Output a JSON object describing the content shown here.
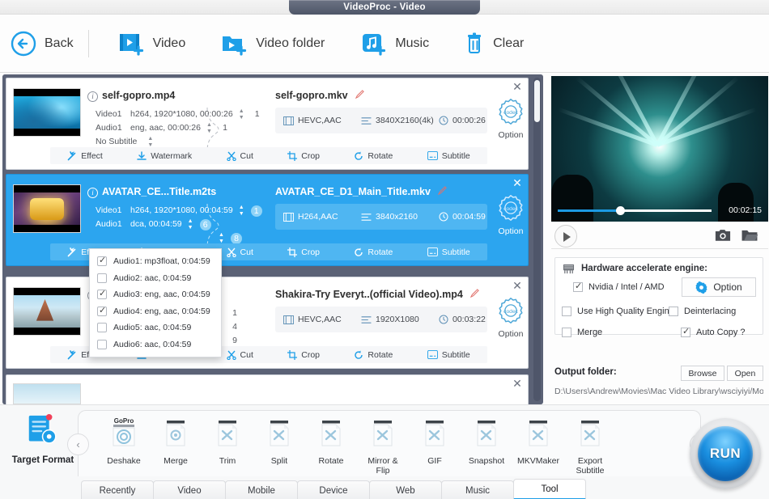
{
  "window": {
    "title": "VideoProc - Video"
  },
  "toolbar": {
    "back": "Back",
    "video": "Video",
    "video_folder": "Video folder",
    "music": "Music",
    "clear": "Clear"
  },
  "rows": [
    {
      "source_name": "self-gopro.mp4",
      "output_name": "self-gopro.mkv",
      "video_label": "Video1",
      "video_info": "h264, 1920*1080, 00:00:26",
      "video_count": "1",
      "audio_label": "Audio1",
      "audio_info": "eng, aac, 00:00:26",
      "audio_count": "1",
      "subtitle_info": "No Subtitle",
      "subtitle_count": "",
      "codec": "HEVC,AAC",
      "resolution": "3840X2160(4k)",
      "duration": "00:00:26",
      "option": "Option",
      "thumb": "sea",
      "selected": false
    },
    {
      "source_name": "AVATAR_CE...Title.m2ts",
      "output_name": "AVATAR_CE_D1_Main_Title.mkv",
      "video_label": "Video1",
      "video_info": "h264, 1920*1080, 00:04:59",
      "video_count": "1",
      "audio_label": "Audio1",
      "audio_info": "dca, 00:04:59",
      "audio_count": "6",
      "subtitle_info": "",
      "subtitle_count": "8",
      "codec": "H264,AAC",
      "resolution": "3840x2160",
      "duration": "00:04:59",
      "option": "Option",
      "thumb": "fox",
      "selected": true
    },
    {
      "source_name": "",
      "output_name": "Shakira-Try Everyt..(official Video).mp4",
      "video_label": "",
      "video_info": "",
      "video_count": "1",
      "audio_label": "",
      "audio_info": "",
      "audio_count": "4",
      "subtitle_info": "",
      "subtitle_count": "9",
      "codec": "HEVC,AAC",
      "resolution": "1920X1080",
      "duration": "00:03:22",
      "option": "Option",
      "thumb": "city",
      "selected": false
    }
  ],
  "row_actions": [
    "Effect",
    "Watermark",
    "Cut",
    "Crop",
    "Rotate",
    "Subtitle"
  ],
  "audio_dropdown": {
    "items": [
      {
        "label": "Audio1: mp3float, 0:04:59",
        "checked": true
      },
      {
        "label": "Audio2: aac, 0:04:59",
        "checked": false
      },
      {
        "label": "Audio3: eng, aac, 0:04:59",
        "checked": true
      },
      {
        "label": "Audio4: eng, aac, 0:04:59",
        "checked": true
      },
      {
        "label": "Audio5: aac, 0:04:59",
        "checked": false
      },
      {
        "label": "Audio6: aac, 0:04:59",
        "checked": false
      }
    ]
  },
  "preview": {
    "current_time": "00:02:15",
    "progress_percent": 40
  },
  "settings": {
    "hw_title": "Hardware accelerate engine:",
    "nvidia_label": "Nvidia / Intel / AMD",
    "nvidia_checked": true,
    "option_label": "Option",
    "hq_label": "Use High Quality Engine",
    "hq_checked": false,
    "deinterlacing_label": "Deinterlacing",
    "deinterlacing_checked": false,
    "merge_label": "Merge",
    "merge_checked": false,
    "autocopy_label": "Auto Copy ?",
    "autocopy_checked": true
  },
  "output": {
    "label": "Output folder:",
    "browse": "Browse",
    "open": "Open",
    "path": "D:\\Users\\Andrew\\Movies\\Mac Video Library\\wsciyiyi/Mo..."
  },
  "bottom": {
    "target_format": "Target Format",
    "tools": [
      {
        "label": "Deshake",
        "icon": "gopro-icon"
      },
      {
        "label": "Merge",
        "icon": "merge-icon"
      },
      {
        "label": "Trim",
        "icon": "trim-icon"
      },
      {
        "label": "Split",
        "icon": "split-icon"
      },
      {
        "label": "Rotate",
        "icon": "rotate-icon"
      },
      {
        "label": "Mirror &\nFlip",
        "icon": "mirror-flip-icon"
      },
      {
        "label": "GIF",
        "icon": "gif-icon"
      },
      {
        "label": "Snapshot",
        "icon": "snapshot-icon"
      },
      {
        "label": "MKVMaker",
        "icon": "mkvmaker-icon"
      },
      {
        "label": "Export\nSubtitle",
        "icon": "export-subtitle-icon"
      }
    ],
    "tabs": [
      {
        "label": "Recently",
        "active": false
      },
      {
        "label": "Video",
        "active": false
      },
      {
        "label": "Mobile",
        "active": false
      },
      {
        "label": "Device",
        "active": false
      },
      {
        "label": "Web",
        "active": false
      },
      {
        "label": "Music",
        "active": false
      },
      {
        "label": "Tool",
        "active": true
      }
    ],
    "run": "RUN"
  },
  "colors": {
    "accent": "#2ca5ef",
    "brand_blue": "#1f9fe8",
    "title_bar": "#5b6276"
  }
}
